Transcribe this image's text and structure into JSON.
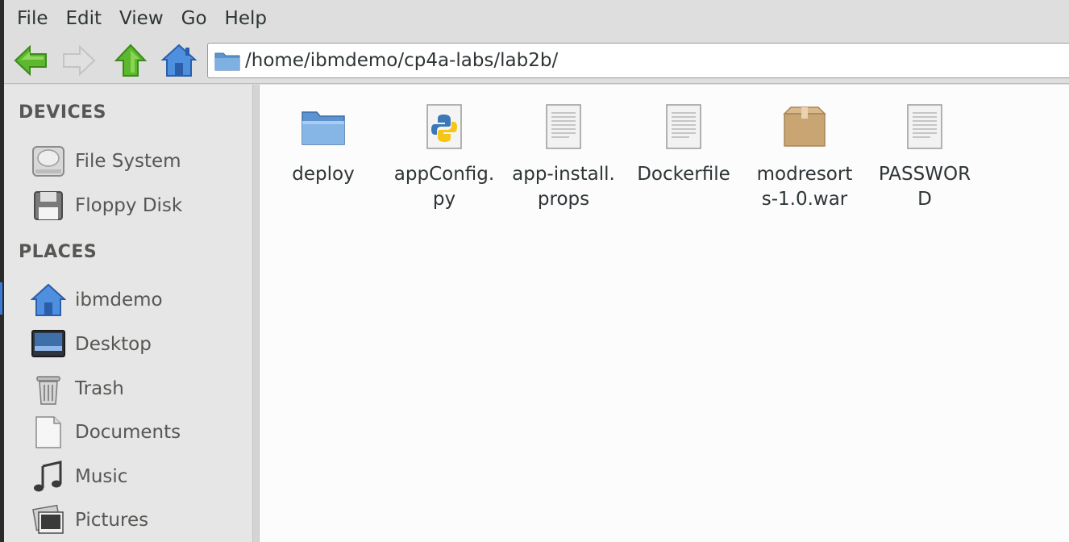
{
  "menubar": {
    "items": [
      "File",
      "Edit",
      "View",
      "Go",
      "Help"
    ]
  },
  "toolbar": {
    "back_icon": "arrow-left-icon",
    "forward_icon": "arrow-right-icon",
    "up_icon": "arrow-up-icon",
    "home_icon": "home-icon"
  },
  "address": {
    "path": "/home/ibmdemo/cp4a-labs/lab2b/"
  },
  "sidebar": {
    "devices_heading": "DEVICES",
    "devices": [
      {
        "label": "File System",
        "icon": "hard-drive-icon"
      },
      {
        "label": "Floppy Disk",
        "icon": "floppy-icon"
      }
    ],
    "places_heading": "PLACES",
    "places": [
      {
        "label": "ibmdemo",
        "icon": "home-icon"
      },
      {
        "label": "Desktop",
        "icon": "desktop-icon"
      },
      {
        "label": "Trash",
        "icon": "trash-icon"
      },
      {
        "label": "Documents",
        "icon": "document-icon"
      },
      {
        "label": "Music",
        "icon": "music-icon"
      },
      {
        "label": "Pictures",
        "icon": "pictures-icon"
      }
    ]
  },
  "files": [
    {
      "name": "deploy",
      "icon": "folder-icon"
    },
    {
      "name": "appConfig.py",
      "icon": "python-file-icon"
    },
    {
      "name": "app-install.props",
      "icon": "text-file-icon"
    },
    {
      "name": "Dockerfile",
      "icon": "text-file-icon"
    },
    {
      "name": "modresorts-1.0.war",
      "icon": "archive-icon"
    },
    {
      "name": "PASSWORD",
      "icon": "text-file-icon"
    }
  ],
  "colors": {
    "accent": "#3a7bd5",
    "arrow_green": "#4caf2a",
    "folder_blue": "#6fa8dc",
    "sidebar_bg": "#e6e6e6",
    "content_bg": "#fcfcfc"
  }
}
